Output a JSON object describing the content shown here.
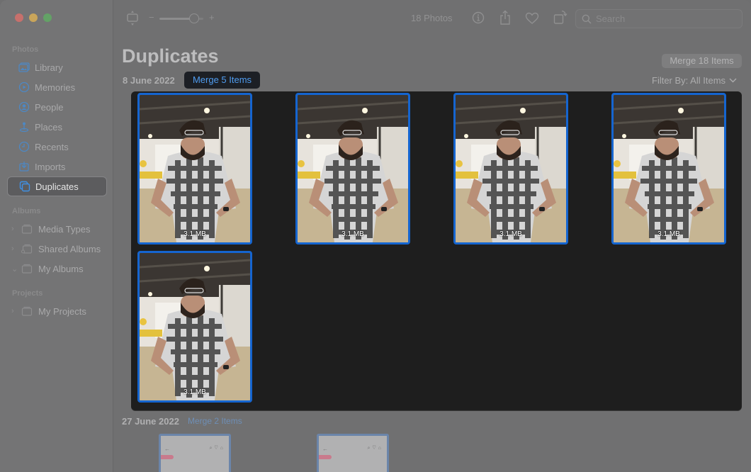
{
  "window": {
    "traffic_lights": [
      "close",
      "minimize",
      "maximize"
    ]
  },
  "sidebar": {
    "sections": [
      {
        "label": "Photos",
        "items": [
          {
            "label": "Library",
            "icon": "photo-library-icon"
          },
          {
            "label": "Memories",
            "icon": "memories-icon"
          },
          {
            "label": "People",
            "icon": "people-icon"
          },
          {
            "label": "Places",
            "icon": "places-pin-icon"
          },
          {
            "label": "Recents",
            "icon": "clock-icon"
          },
          {
            "label": "Imports",
            "icon": "import-tray-icon"
          },
          {
            "label": "Duplicates",
            "icon": "duplicates-icon",
            "selected": true
          }
        ]
      },
      {
        "label": "Albums",
        "items": [
          {
            "label": "Media Types",
            "expanded": false
          },
          {
            "label": "Shared Albums",
            "expanded": false
          },
          {
            "label": "My Albums",
            "expanded": true
          }
        ]
      },
      {
        "label": "Projects",
        "items": [
          {
            "label": "My Projects",
            "expanded": false
          }
        ]
      }
    ]
  },
  "toolbar": {
    "zoom_minus": "−",
    "zoom_plus": "+",
    "zoom_level_fraction": 0.8,
    "photo_count": "18 Photos",
    "search_placeholder": "Search",
    "search_value": ""
  },
  "header": {
    "title": "Duplicates",
    "merge_all_label": "Merge 18 Items",
    "filter_label": "Filter By: All Items"
  },
  "groups": [
    {
      "date": "8 June 2022",
      "merge_label": "Merge 5 Items",
      "items": [
        {
          "size": "3.1 MB",
          "selected": true
        },
        {
          "size": "3.1 MB",
          "selected": true
        },
        {
          "size": "3.1 MB",
          "selected": true
        },
        {
          "size": "3.1 MB",
          "selected": true
        },
        {
          "size": "3.1 MB",
          "selected": true
        }
      ]
    },
    {
      "date": "27 June 2022",
      "merge_label": "Merge 2 Items",
      "items": [
        {
          "thumbnail": "app-screenshot",
          "back_glyph": "←",
          "icons": "⌕♡⌂"
        },
        {
          "thumbnail": "app-screenshot",
          "back_glyph": "←",
          "icons": "⌕♡⌂"
        }
      ]
    }
  ]
}
